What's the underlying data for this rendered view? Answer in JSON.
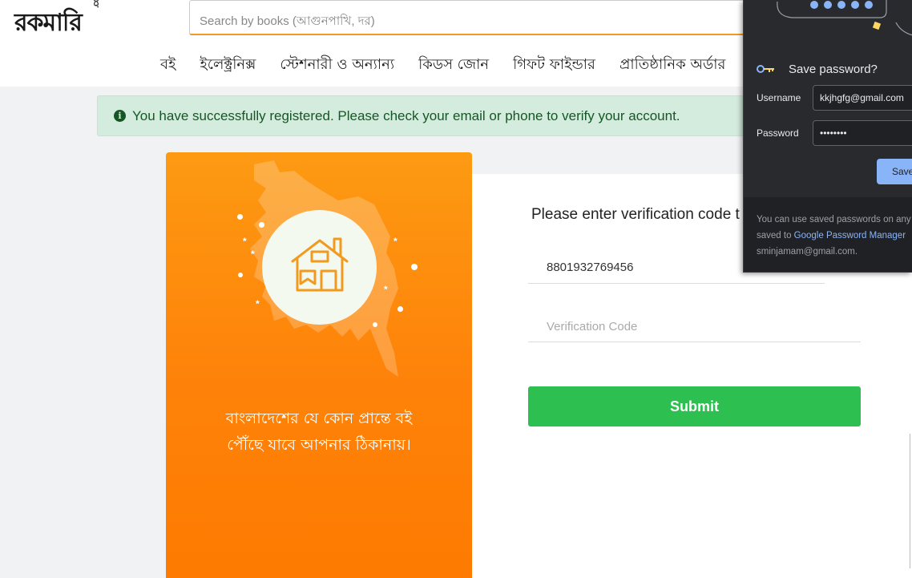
{
  "header": {
    "logo_text": "রকমারি",
    "logo_suffix": ".com",
    "search_placeholder": "Search by books (আগুনপাখি, দর)",
    "nav": [
      "বই",
      "ইলেক্ট্রনিক্স",
      "স্টেশনারী ও অন্যান্য",
      "কিডস জোন",
      "গিফট ফাইন্ডার",
      "প্রাতিষ্ঠানিক অর্ডার"
    ]
  },
  "alert": {
    "icon": "info-circle-icon",
    "message": "You have successfully registered. Please check your email or phone to verify your account."
  },
  "promo": {
    "tagline_line1": "বাংলাদেশের যে কোন প্রান্তে বই",
    "tagline_line2": "পৌঁছে যাবে আপনার ঠিকানায়।"
  },
  "form": {
    "title": "Please enter verification code t",
    "phone_value": "8801932769456",
    "code_placeholder": "Verification Code",
    "submit_label": "Submit"
  },
  "password_popup": {
    "title": "Save password?",
    "username_label": "Username",
    "username_value": "kkjhgfg@gmail.com",
    "password_label": "Password",
    "password_value": "••••••••",
    "save_label": "Save",
    "footer_line1": "You can use saved passwords on any",
    "footer_line2_prefix": "saved to ",
    "footer_link": "Google Password Manager",
    "footer_line3": "sminjamam@gmail.com."
  },
  "colors": {
    "accent_orange": "#fe830a",
    "submit_green": "#2dbf4f",
    "alert_bg": "#d4ecdd",
    "popup_bg": "#292a2d",
    "link_blue": "#8ab4f8"
  }
}
